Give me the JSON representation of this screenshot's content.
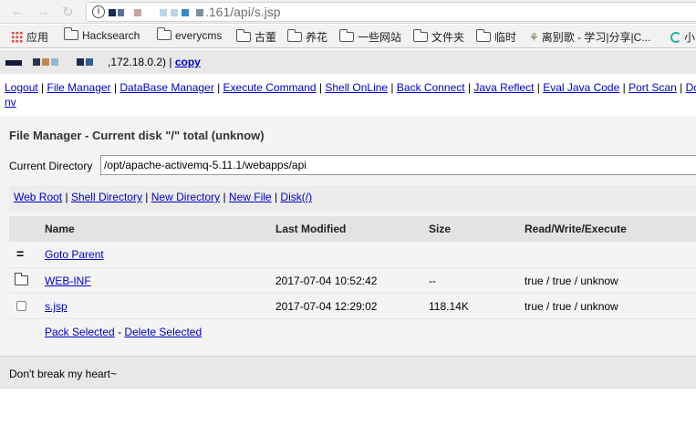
{
  "browser": {
    "url_visible": ".161/api/s.jsp",
    "bookmarks": [
      {
        "label": "应用",
        "icon": "apps-grid-icon"
      },
      {
        "label": "Hacksearch",
        "icon": "folder-icon"
      },
      {
        "label": "everycms",
        "icon": "folder-icon"
      },
      {
        "label": "古董",
        "icon": "folder-icon"
      },
      {
        "label": "养花",
        "icon": "folder-icon"
      },
      {
        "label": "一些网站",
        "icon": "folder-icon"
      },
      {
        "label": "文件夹",
        "icon": "folder-icon"
      },
      {
        "label": "临时",
        "icon": "folder-icon"
      },
      {
        "label": "离别歌 - 学习|分享|C...",
        "icon": "plant-icon"
      },
      {
        "label": "小",
        "icon": "loop-icon"
      }
    ]
  },
  "status": {
    "ip_text": ",172.18.0.2) |",
    "copy_label": "copy"
  },
  "menu": {
    "items": [
      "Logout",
      "File Manager",
      "DataBase Manager",
      "Execute Command",
      "Shell OnLine",
      "Back Connect",
      "Java Reflect",
      "Eval Java Code",
      "Port Scan",
      "Do"
    ],
    "overflow_text": "nv"
  },
  "file_manager": {
    "title": "File Manager - Current disk \"/\" total (unknow)",
    "current_dir_label": "Current Directory",
    "current_dir_value": "/opt/apache-activemq-5.11.1/webapps/api",
    "quick_links": [
      "Web Root",
      "Shell Directory",
      "New Directory",
      "New File",
      "Disk(/)"
    ],
    "columns": {
      "name": "Name",
      "last_modified": "Last Modified",
      "size": "Size",
      "rwx": "Read/Write/Execute"
    },
    "parent_glyph": "=",
    "goto_parent": "Goto Parent",
    "rows": [
      {
        "type": "folder",
        "name": "WEB-INF",
        "modified": "2017-07-04 10:52:42",
        "size": "--",
        "rwx": "true / true / unknow"
      },
      {
        "type": "file",
        "name": "s.jsp",
        "modified": "2017-07-04 12:29:02",
        "size": "118.14K",
        "rwx": "true / true / unknow"
      }
    ],
    "pack_selected": "Pack Selected",
    "action_sep": "-",
    "delete_selected": "Delete Selected"
  },
  "footer": {
    "text": "Don't break my heart~"
  },
  "colors": {
    "link": "#0000cc",
    "header_bg": "#e3e3e3",
    "panel_bg": "#f4f4f4",
    "status_bg": "#e8e8e8"
  }
}
